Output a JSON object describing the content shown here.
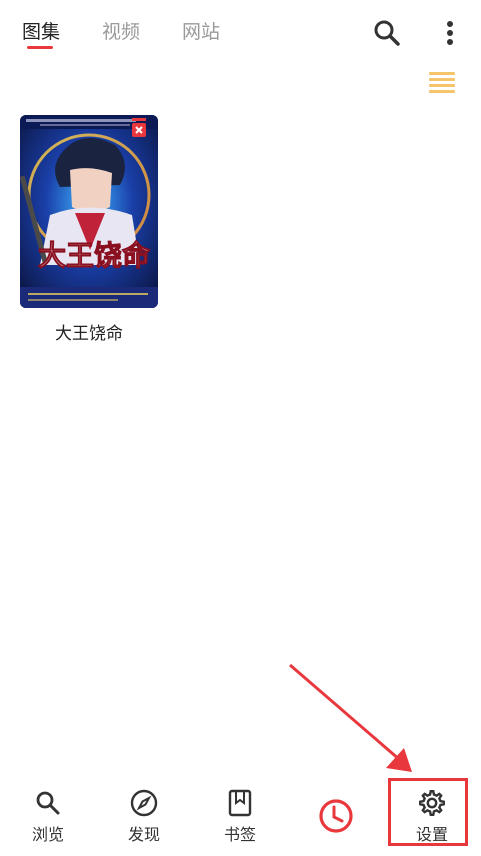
{
  "tabs": [
    {
      "label": "图集",
      "active": true
    },
    {
      "label": "视频",
      "active": false
    },
    {
      "label": "网站",
      "active": false
    }
  ],
  "toolbar": {
    "search_icon": "search-icon",
    "more_icon": "more-vertical-icon",
    "list_toggle_icon": "list-view-icon"
  },
  "gallery": {
    "items": [
      {
        "title": "大王饶命",
        "cover_text": "大王饶命",
        "badge": "delete-icon"
      }
    ]
  },
  "bottom_nav": {
    "items": [
      {
        "label": "浏览",
        "icon": "search-icon"
      },
      {
        "label": "发现",
        "icon": "compass-icon"
      },
      {
        "label": "书签",
        "icon": "bookmark-icon"
      },
      {
        "label": "",
        "icon": "clock-icon"
      },
      {
        "label": "设置",
        "icon": "gear-icon"
      }
    ]
  },
  "colors": {
    "accent": "#e8383d",
    "list_toggle": "#f6c46a",
    "inactive_tab": "#9a9a9a"
  }
}
